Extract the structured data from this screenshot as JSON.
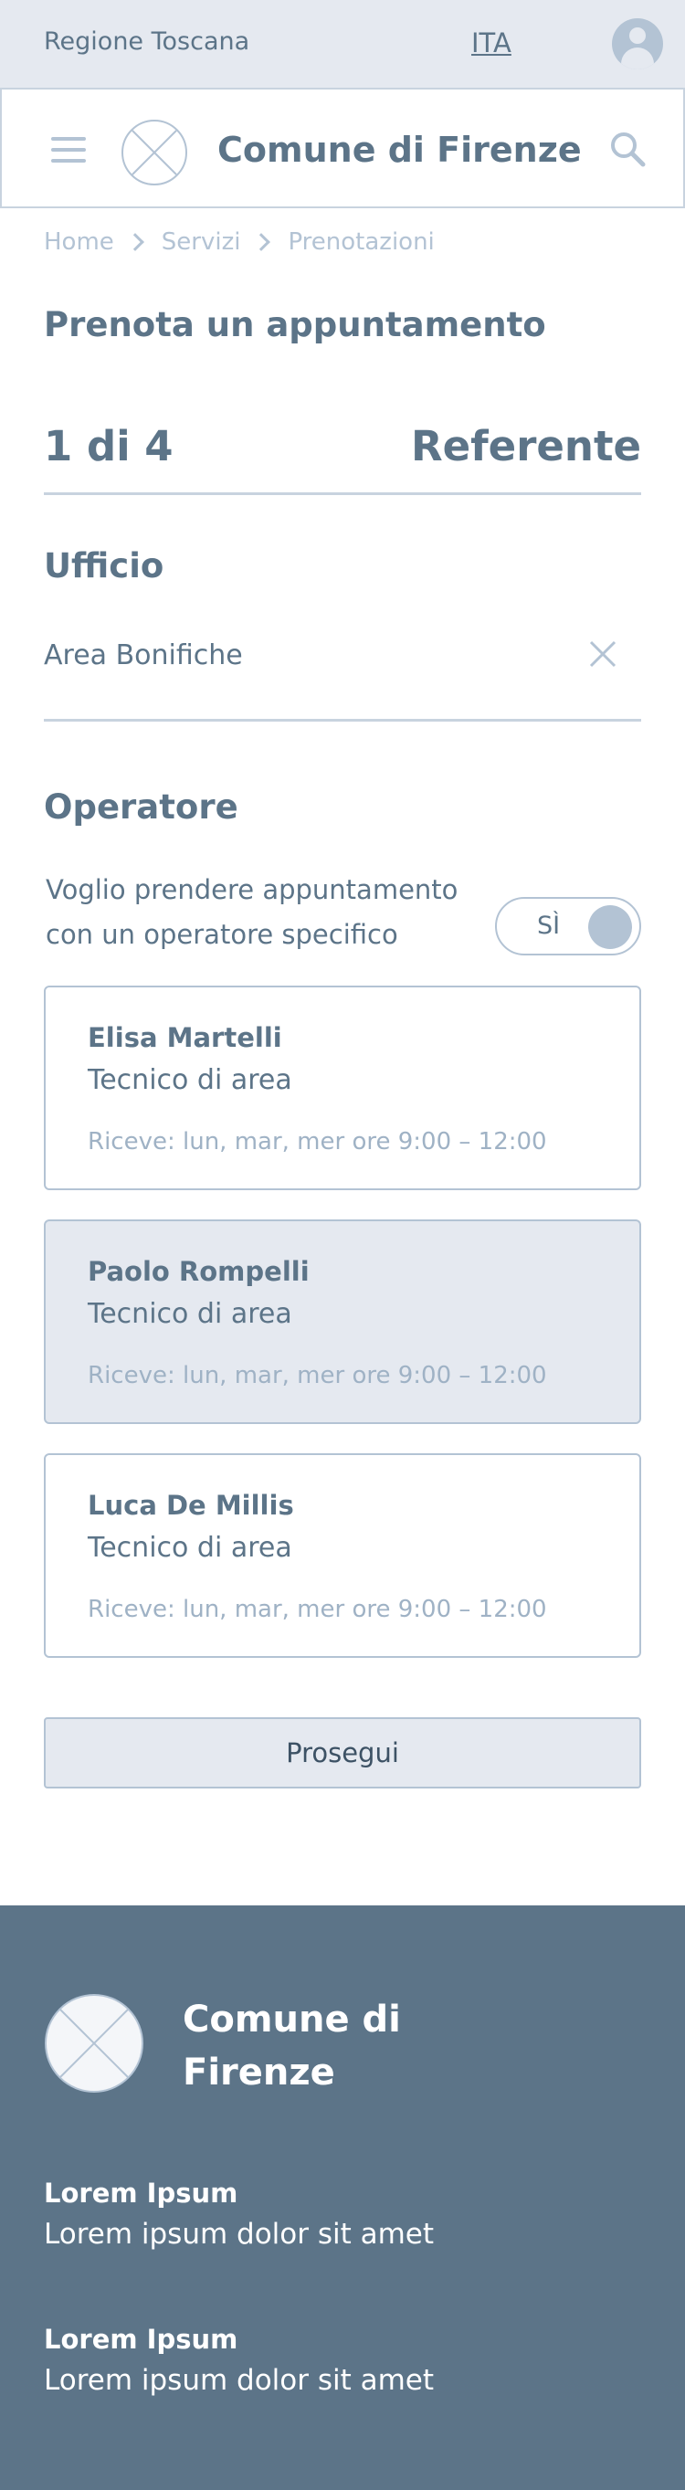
{
  "topbar": {
    "region": "Regione Toscana",
    "language": "ITA"
  },
  "header": {
    "title": "Comune di Firenze"
  },
  "breadcrumb": [
    "Home",
    "Servizi",
    "Prenotazioni"
  ],
  "page": {
    "title": "Prenota un appuntamento"
  },
  "stepper": {
    "step": "1 di 4",
    "label": "Referente"
  },
  "office": {
    "title": "Ufficio",
    "value": "Area Bonifiche"
  },
  "operator": {
    "title": "Operatore",
    "question": "Voglio prendere appuntamento con un operatore specifico",
    "toggle_label": "SÌ"
  },
  "operators": [
    {
      "name": "Elisa Martelli",
      "role": "Tecnico di area",
      "hours": "Riceve: lun, mar, mer ore 9:00 – 12:00",
      "selected": false
    },
    {
      "name": "Paolo Rompelli",
      "role": "Tecnico di area",
      "hours": "Riceve: lun, mar, mer ore 9:00 – 12:00",
      "selected": true
    },
    {
      "name": "Luca De Millis",
      "role": "Tecnico di area",
      "hours": "Riceve: lun, mar, mer ore 9:00 – 12:00",
      "selected": false
    }
  ],
  "actions": {
    "proceed": "Prosegui"
  },
  "footer": {
    "title": "Comune di Firenze",
    "blocks": [
      {
        "heading": "Lorem Ipsum",
        "text": "Lorem ipsum dolor sit amet"
      },
      {
        "heading": "Lorem Ipsum",
        "text": "Lorem ipsum dolor sit amet"
      }
    ]
  },
  "icons": {
    "menu": "hamburger-menu-icon",
    "logo": "placeholder-logo-icon",
    "search": "search-icon",
    "clear": "close-icon",
    "user": "user-icon",
    "breadcrumb_separator": "chevron-right-icon"
  },
  "colors": {
    "primary": "#5c7488",
    "light": "#e5e9f0",
    "border": "#c8d3df",
    "muted": "#b3c3d4",
    "footer_bg": "#5c7488"
  }
}
